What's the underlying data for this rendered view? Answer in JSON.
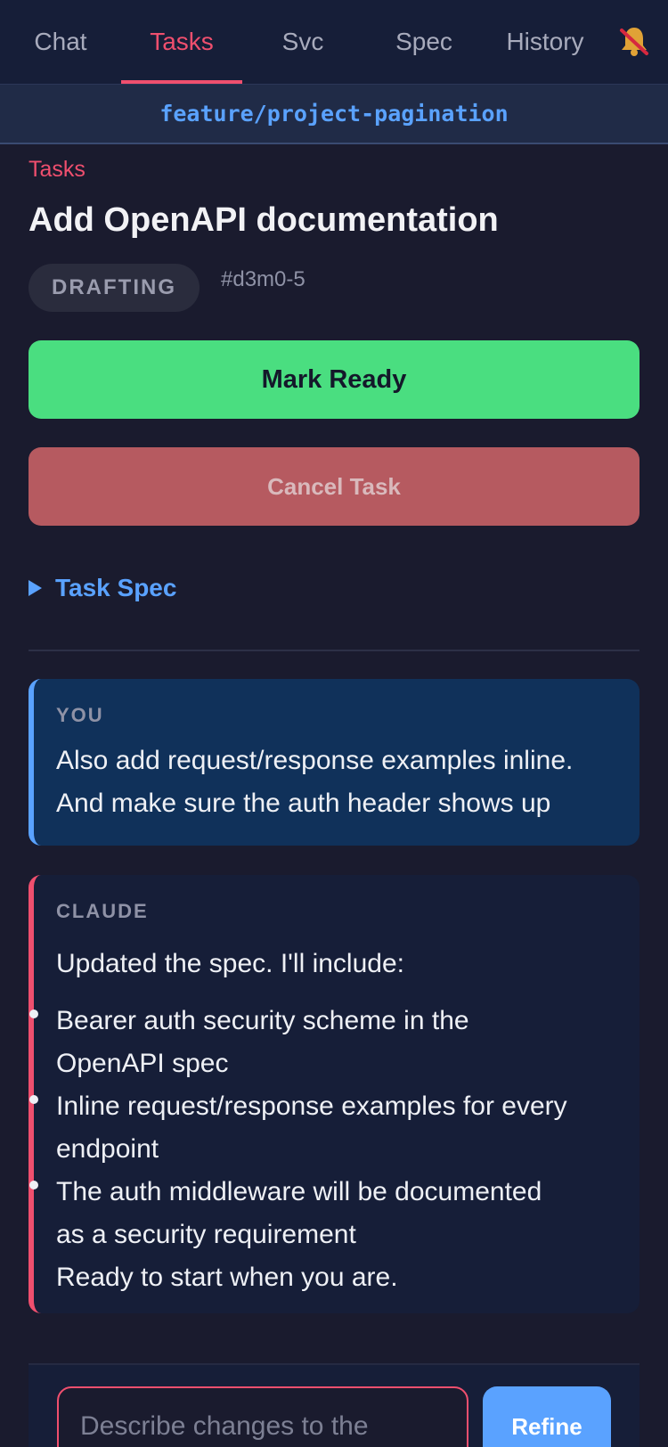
{
  "nav": {
    "tabs": [
      {
        "label": "Chat",
        "active": false
      },
      {
        "label": "Tasks",
        "active": true
      },
      {
        "label": "Svc",
        "active": false
      },
      {
        "label": "Spec",
        "active": false
      },
      {
        "label": "History",
        "active": false
      }
    ],
    "notification_icon": "bell-muted-icon"
  },
  "branch": "feature/project-pagination",
  "breadcrumb": "Tasks",
  "task": {
    "title": "Add OpenAPI documentation",
    "status": "DRAFTING",
    "id": "#d3m0-5"
  },
  "actions": {
    "mark_ready": "Mark Ready",
    "cancel": "Cancel Task"
  },
  "spec_toggle": "Task Spec",
  "messages": [
    {
      "author": "YOU",
      "lines": [
        "Also add request/response examples inline.",
        "And make sure the auth header shows up"
      ]
    },
    {
      "author": "CLAUDE",
      "intro": "Updated the spec. I'll include:",
      "bullets": [
        [
          "Bearer auth security scheme in the",
          "OpenAPI spec"
        ],
        [
          "Inline request/response examples for every",
          "endpoint"
        ],
        [
          "The auth middleware will be documented",
          "as a security requirement"
        ]
      ],
      "outro": "Ready to start when you are."
    }
  ],
  "composer": {
    "placeholder": "Describe changes to the",
    "submit_label": "Refine"
  },
  "colors": {
    "accent": "#ef4f6e",
    "link": "#5aa2ff",
    "ready": "#4ade80",
    "cancel": "#b65a60"
  }
}
